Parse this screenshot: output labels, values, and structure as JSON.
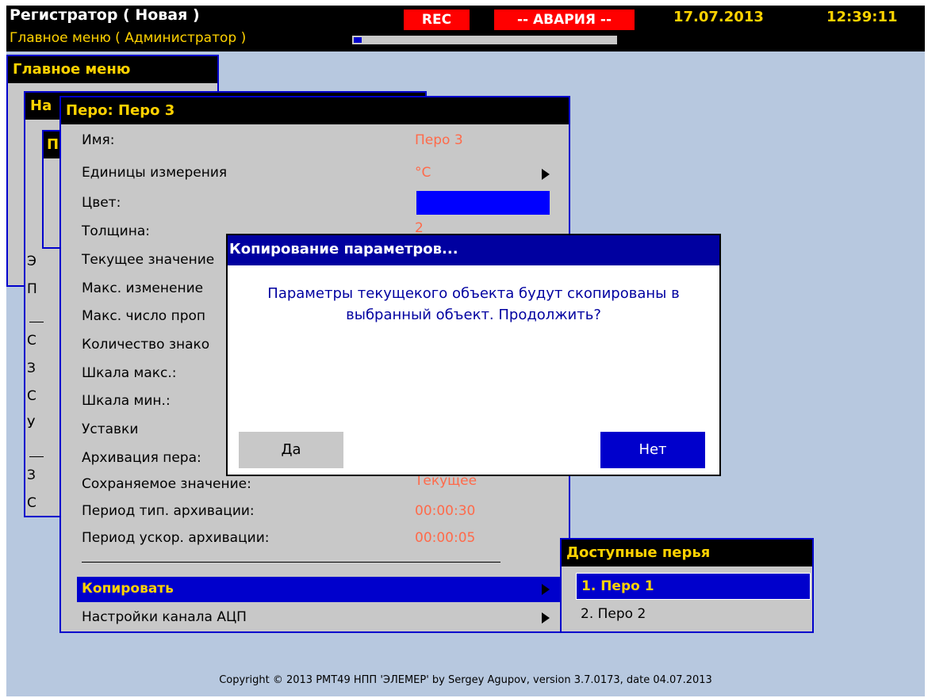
{
  "status": {
    "app_title": "Регистратор ( Новая )",
    "subtitle": "Главное меню ( Администратор )",
    "rec": "REC",
    "alarm": "-- АВАРИЯ --",
    "date": "17.07.2013",
    "time": "12:39:11",
    "progress_percent": 3
  },
  "bg_windows": {
    "main_title": "Главное меню",
    "nastr_title": "На",
    "inner_title": "П",
    "rows": [
      "Э",
      "П",
      "С",
      "З",
      "С",
      "У",
      "З",
      "С"
    ]
  },
  "pen": {
    "title": "Перо: Перо 3",
    "rows": [
      {
        "label": "Имя:",
        "value": "Перо 3"
      },
      {
        "label": "Единицы измерения",
        "value": "°C"
      },
      {
        "label": "Цвет:",
        "value": ""
      },
      {
        "label": "Толщина:",
        "value": "2"
      },
      {
        "label": "Текущее значение",
        "value": ""
      },
      {
        "label": "Макс. изменение",
        "value": ""
      },
      {
        "label": "Макс. число проп",
        "value": ""
      },
      {
        "label": "Количество знако",
        "value": ""
      },
      {
        "label": "Шкала макс.:",
        "value": ""
      },
      {
        "label": "Шкала мин.:",
        "value": ""
      },
      {
        "label": "Уставки",
        "value": ""
      },
      {
        "label": "Архивация пера:",
        "value": ""
      },
      {
        "label": "Сохраняемое значение:",
        "value": "Текущее"
      },
      {
        "label": "Период тип. архивации:",
        "value": "00:00:30"
      },
      {
        "label": "Период ускор. архивации:",
        "value": "00:00:05"
      }
    ],
    "copy_label": "Копировать",
    "adc_label": "Настройки канала АЦП",
    "color_value": "#0000ff"
  },
  "pens_menu": {
    "title": "Доступные перья",
    "items": [
      "1. Перо 1",
      "2. Перо 2"
    ]
  },
  "dialog": {
    "title": "Копирование параметров...",
    "message_line1": "Параметры текущекого объекта будут скопированы в",
    "message_line2": "выбранный объект. Продолжить?",
    "yes": "Да",
    "no": "Нет"
  },
  "copyright": "Copyright © 2013 PMT49 НПП 'ЭЛЕМЕР' by Sergey Agupov, version 3.7.0173, date 04.07.2013",
  "colors": {
    "accent": "#0000cc",
    "title_text": "#ffd200",
    "value_text": "#ff6a4a",
    "alarm": "#ff0000",
    "desktop": "#b7c8df"
  }
}
